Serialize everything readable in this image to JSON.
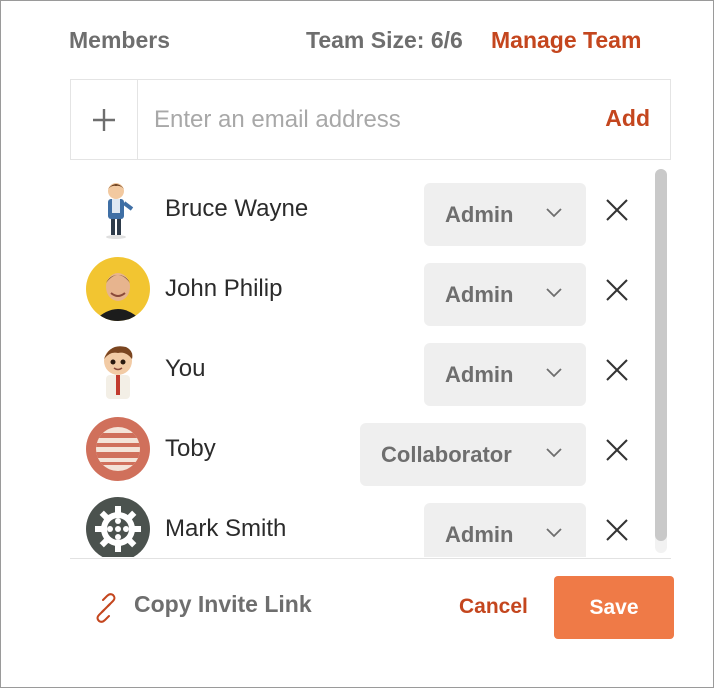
{
  "header": {
    "members_title": "Members",
    "team_size": "Team Size: 6/6",
    "manage_team": "Manage Team"
  },
  "invite": {
    "plus_icon": "plus-icon",
    "email_placeholder": "Enter an email address",
    "email_value": "",
    "add_label": "Add"
  },
  "members": [
    {
      "name": "Bruce Wayne",
      "role": "Admin",
      "avatar": "cartoon-man-avatar"
    },
    {
      "name": "John Philip",
      "role": "Admin",
      "avatar": "photo-avatar"
    },
    {
      "name": "You",
      "role": "Admin",
      "avatar": "cartoon-boy-avatar"
    },
    {
      "name": "Toby",
      "role": "Collaborator",
      "avatar": "planet-avatar"
    },
    {
      "name": "Mark Smith",
      "role": "Admin",
      "avatar": "gear-avatar"
    }
  ],
  "footer": {
    "copy_invite_link": "Copy Invite Link",
    "cancel": "Cancel",
    "save": "Save"
  },
  "colors": {
    "accent": "#c4461e",
    "save_bg": "#ef7a47",
    "text_muted": "#6e6e6e",
    "select_bg": "#efefef"
  }
}
